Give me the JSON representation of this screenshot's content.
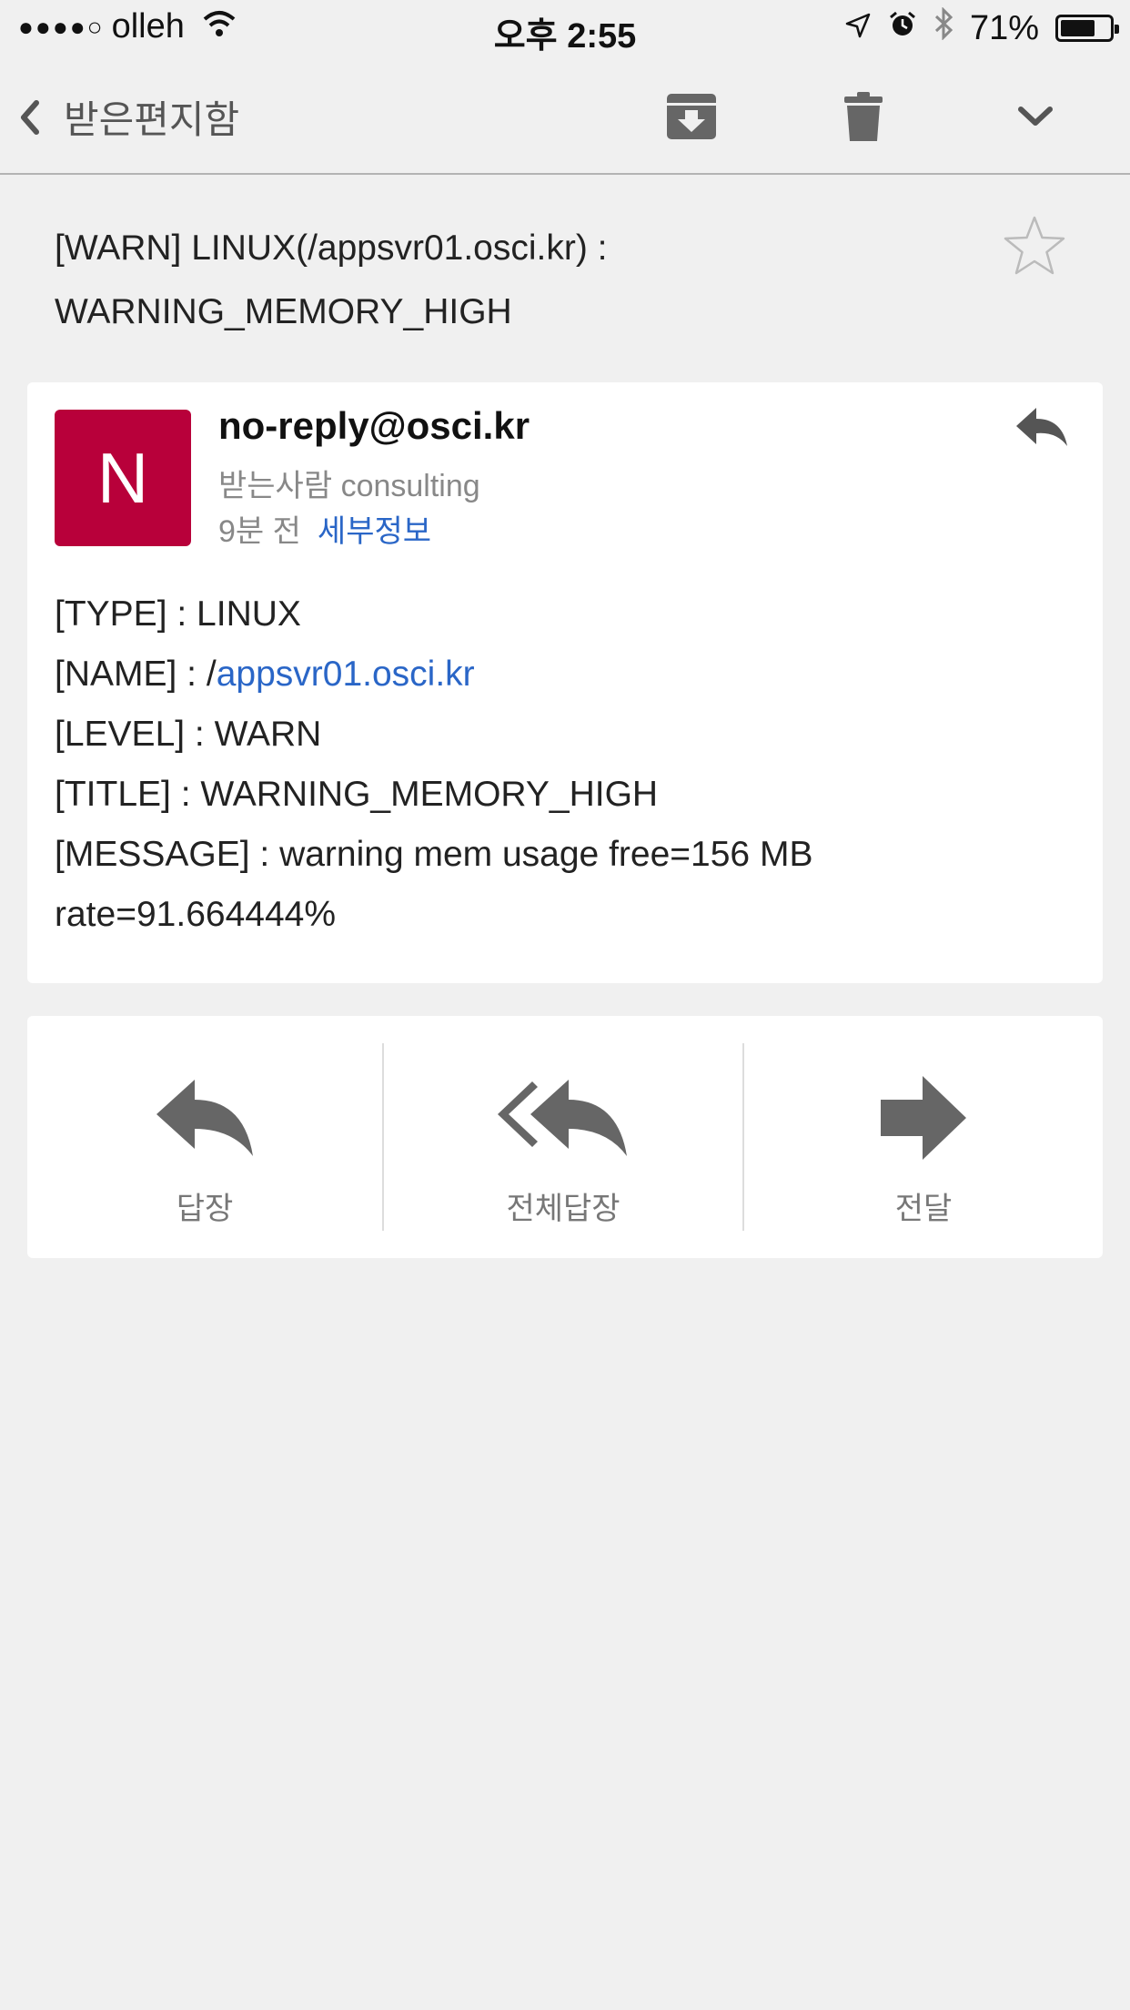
{
  "status_bar": {
    "signal": "●●●●○",
    "carrier": "olleh",
    "time": "오후 2:55",
    "battery_percent": "71%",
    "battery_level": 0.71
  },
  "nav": {
    "back_label": "받은편지함",
    "icons": [
      "chevron-left-icon",
      "archive-icon",
      "trash-icon",
      "chevron-down-icon"
    ]
  },
  "email": {
    "subject_line1": "[WARN] LINUX(/appsvr01.osci.kr) :",
    "subject_line2": "WARNING_MEMORY_HIGH",
    "starred": false,
    "avatar_letter": "N",
    "avatar_color": "#b8003a",
    "sender": "no-reply@osci.kr",
    "recipient": "받는사람 consulting",
    "time_ago": "9분 전",
    "details_label": "세부정보",
    "body": {
      "type_line": "[TYPE] : LINUX",
      "name_prefix": "[NAME] : /",
      "name_link": "appsvr01.osci.kr",
      "level_line": "[LEVEL] : WARN",
      "title_line": "[TITLE] : WARNING_MEMORY_HIGH",
      "message_line1": "[MESSAGE] : warning mem usage free=156 MB",
      "message_line2": "rate=91.664444%"
    }
  },
  "actions": {
    "reply": "답장",
    "reply_all": "전체답장",
    "forward": "전달"
  },
  "colors": {
    "link": "#2a66c7",
    "icon_gray": "#666666",
    "background": "#f0f0f0"
  }
}
